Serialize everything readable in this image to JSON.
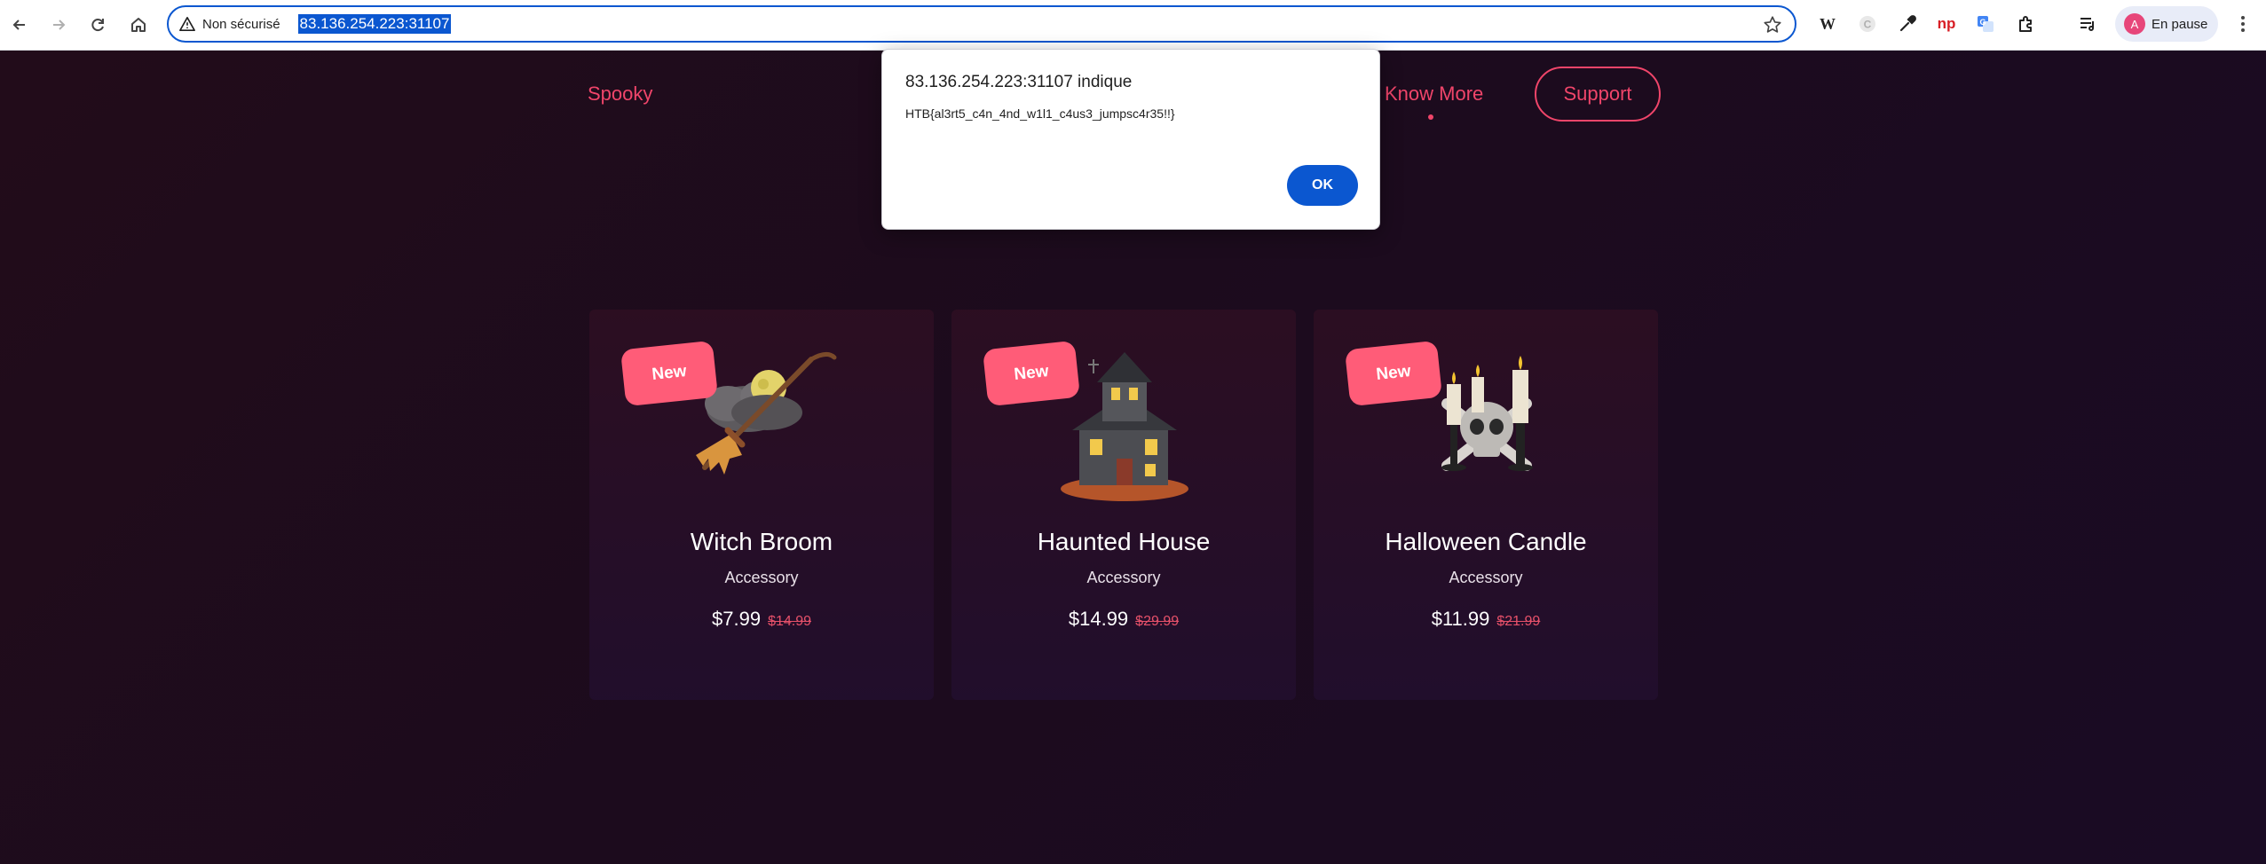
{
  "browser": {
    "security_label": "Non sécurisé",
    "url": "83.136.254.223:31107",
    "profile_initial": "A",
    "profile_label": "En pause",
    "extensions": [
      "wikipedia-icon",
      "c-extension-icon",
      "eyedropper-icon",
      "np-extension-icon",
      "translate-icon",
      "puzzle-icon",
      "reading-list-icon"
    ]
  },
  "nav": {
    "brand": "Spooky",
    "know_more": "Know More",
    "support": "Support"
  },
  "alert": {
    "title": "83.136.254.223:31107 indique",
    "message": "HTB{al3rt5_c4n_4nd_w1l1_c4us3_jumpsc4r35!!}",
    "ok_label": "OK"
  },
  "products": [
    {
      "badge": "New",
      "name": "Witch Broom",
      "category": "Accessory",
      "price": "$7.99",
      "old_price": "$14.99",
      "icon": "witch-broom-icon"
    },
    {
      "badge": "New",
      "name": "Haunted House",
      "category": "Accessory",
      "price": "$14.99",
      "old_price": "$29.99",
      "icon": "haunted-house-icon"
    },
    {
      "badge": "New",
      "name": "Halloween Candle",
      "category": "Accessory",
      "price": "$11.99",
      "old_price": "$21.99",
      "icon": "halloween-candle-icon"
    }
  ],
  "colors": {
    "accent": "#f0456a",
    "badge": "#ff5c78",
    "alert_button": "#0b57d0",
    "page_bg": "#1c0d1a"
  }
}
